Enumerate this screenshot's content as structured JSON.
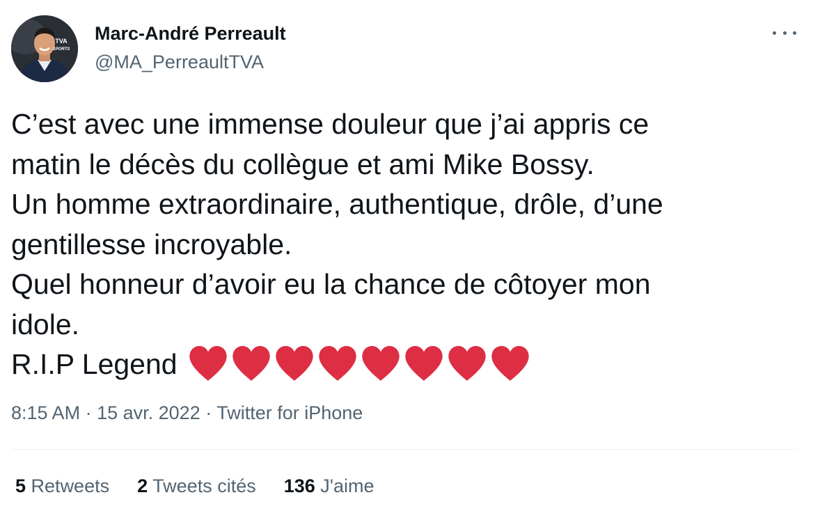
{
  "author": {
    "name": "Marc-André Perreault",
    "handle": "@MA_PerreaultTVA",
    "avatar_badge_top": "TVA",
    "avatar_badge_bottom": "SPORTS"
  },
  "tweet": {
    "lines": [
      "C’est avec une immense douleur que j’ai appris ce",
      "matin le décès du collègue et ami Mike Bossy.",
      "Un homme extraordinaire, authentique, drôle, d’une",
      "gentillesse incroyable.",
      "Quel honneur d’avoir eu la chance de côtoyer mon",
      "idole.",
      "R.I.P Legend"
    ],
    "emoji_count": 8,
    "emoji_icon": "red-heart-icon",
    "emoji_color": "#dd2e44"
  },
  "meta": {
    "time": "8:15 AM",
    "sep1": " · ",
    "date": "15 avr. 2022",
    "sep2": " · ",
    "source": "Twitter for iPhone"
  },
  "stats": {
    "retweets_count": "5",
    "retweets_label": "Retweets",
    "quotes_count": "2",
    "quotes_label": "Tweets cités",
    "likes_count": "136",
    "likes_label": "J'aime"
  },
  "colors": {
    "text_primary": "#0f1419",
    "text_secondary": "#536471",
    "divider": "#eff3f4",
    "heart": "#dd2e44"
  },
  "icons": {
    "more": "more-dots-icon"
  }
}
